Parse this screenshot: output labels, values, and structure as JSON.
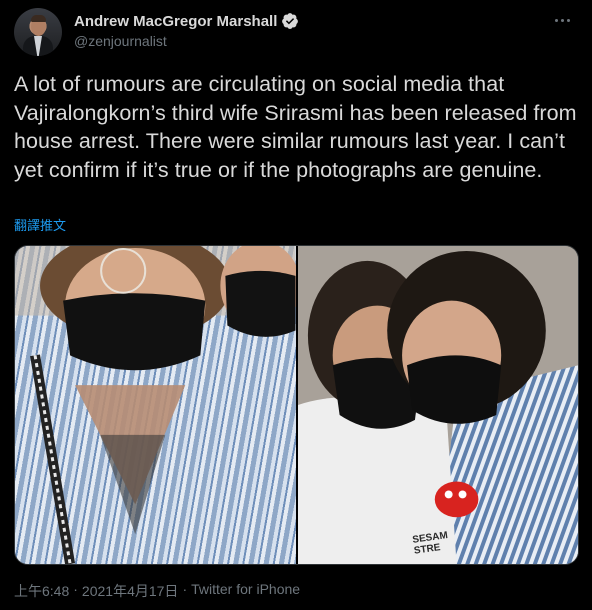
{
  "author": {
    "display_name": "Andrew MacGregor Marshall",
    "handle": "@zenjournalist",
    "verified": true,
    "avatar_icon": "profile-photo"
  },
  "tweet": {
    "text": "A lot of rumours are circulating on social media that Vajiralongkorn’s third wife Srirasmi has been released from house arrest. There were similar rumours last year. I can’t yet confirm if it’s true or if the photographs are genuine.",
    "translate_label": "翻譯推文",
    "media": [
      {
        "description_icon": "photo-left",
        "overlay_text": ""
      },
      {
        "description_icon": "photo-right",
        "overlay_text": "SESAM STRE"
      }
    ]
  },
  "meta": {
    "time": "上午6:48",
    "separator": "·",
    "date": "2021年4月17日",
    "source": "Twitter for iPhone"
  },
  "colors": {
    "background": "#000000",
    "text_primary": "#d9d9d9",
    "text_secondary": "#6e767d",
    "link": "#1d9bf0",
    "verified_badge": "#d9d9d9"
  }
}
